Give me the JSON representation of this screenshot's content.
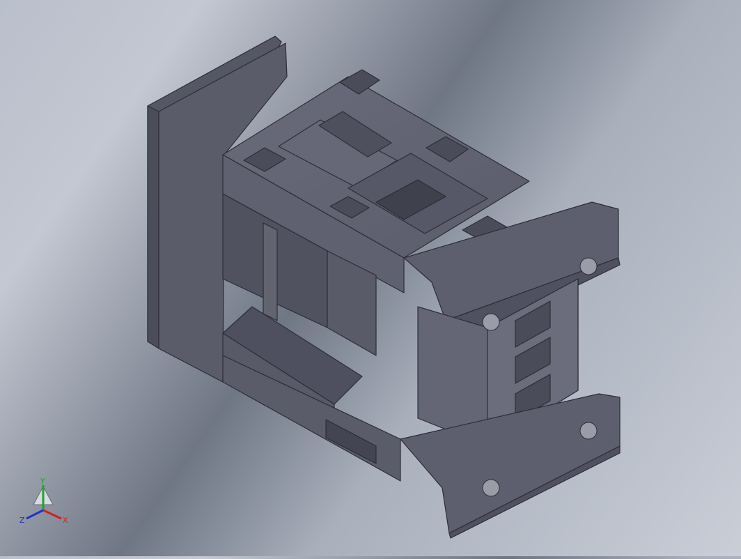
{
  "viewport": {
    "background_top": "#b9bfcb",
    "background_mid": "#6f7684",
    "background_bottom": "#c9ced7",
    "model_color": "#5c5e6d"
  },
  "triad": {
    "x_label": "X",
    "y_label": "Y",
    "z_label": "Z",
    "x_color": "#d22020",
    "y_color": "#1fa32a",
    "z_color": "#2430c8"
  }
}
